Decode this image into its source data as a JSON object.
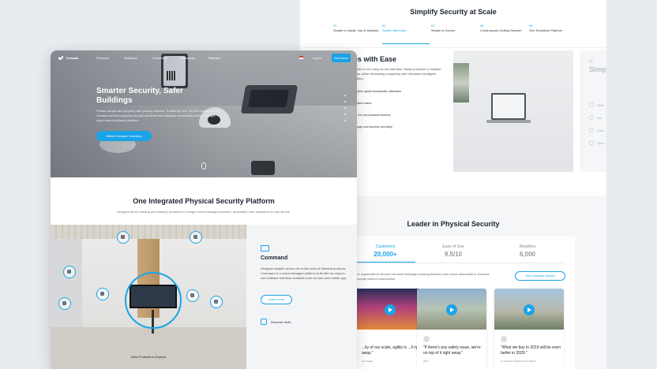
{
  "back_page": {
    "title": "Simplify Security at Scale",
    "steps": [
      {
        "num": "01",
        "label": "Simple to Install, Use & Maintain"
      },
      {
        "num": "02",
        "label": "Scales with Ease"
      },
      {
        "num": "03",
        "label": "Simple to Secure"
      },
      {
        "num": "04",
        "label": "Continuously Getting Smarter"
      },
      {
        "num": "05",
        "label": "One Seamless Platform"
      }
    ],
    "active_step": 1,
    "feature": {
      "heading": "es with Ease",
      "description": "all devices in one easy-to-use interface. Easily provision to multiple locations, while eliminating complexity with Verkada's intelligent automation.",
      "items": [
        "fficient uplink bandwidth utilization",
        "limited users",
        "ce for cloud-based access",
        "anage and access remotely"
      ]
    },
    "peek": {
      "num": "03",
      "title": "Simpl",
      "items": [
        "Setti",
        "Ver",
        "Char",
        "Seco"
      ]
    },
    "leader": {
      "title": "Leader in Physical Security",
      "stats": [
        {
          "label": "Customers",
          "value": "20,000+"
        },
        {
          "label": "Ease of Use",
          "value": "9.5/10"
        },
        {
          "label": "Resellers",
          "value": "6,000"
        }
      ],
      "description": "ore organizations around the world leverage evolving features and unlock actionable to increase security without compromise.",
      "case_button": "See customer stories",
      "cases": [
        {
          "quote": "...ity of our scale, agility is ...ll right away.\"",
          "who": "Las Vegas"
        },
        {
          "quote": "\"If there's any safety issue, we're on top of it right away.\"",
          "who": "CEO"
        },
        {
          "quote": "\"What we buy in 2019 will be even better in 2029.\"",
          "who": "La Canada Unified School District"
        }
      ]
    }
  },
  "front_page": {
    "nav": {
      "logo": "Verkada",
      "items": [
        "Products",
        "Solutions",
        "Customers",
        "Resources",
        "Partners"
      ],
      "login": "Log in",
      "cta": "Get Demo"
    },
    "hero": {
      "title": "Smarter Security, Safer Buildings",
      "description": "Protect people and property with privacy-minded. Trusted by over 20,000 organizations, Verkada delivers physical security solutions that integrate seamlessly behind a single, cloud-based software platform.",
      "button": "Watch Verkada Overview"
    },
    "platform": {
      "title": "One Integrated Physical Security Platform",
      "subtitle": "Integrate all our leading and industry products in a single cloud-managed platform, accessible from anywhere on any device."
    },
    "office_caption": "Click Products to Explore",
    "product": {
      "title": "Command",
      "description": "Integrate insights across the entire suite of Verkada products. Command is a cloud-managed platform built with an easy-to-use software interface available both via web and mobile app.",
      "learn_more": "Learn more",
      "discover": "Discover Helix"
    }
  },
  "colors": {
    "accent": "#1aa3e8",
    "background": "#e8ebef"
  }
}
